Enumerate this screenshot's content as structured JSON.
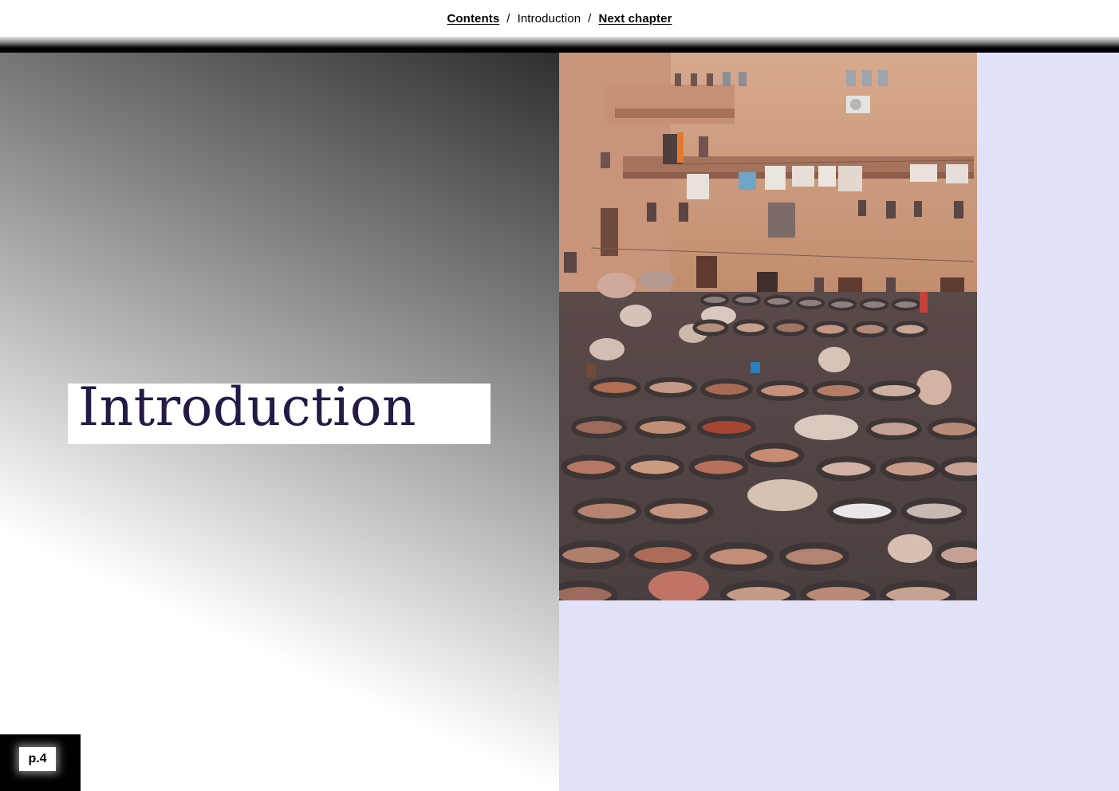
{
  "nav": {
    "contents_label": "Contents",
    "separator": "/",
    "current_label": "Introduction",
    "next_label": "Next chapter"
  },
  "chapter": {
    "title": "Introduction"
  },
  "page": {
    "label": "p.4"
  },
  "colors": {
    "title_text": "#241a45",
    "right_panel": "#e1e2f7",
    "badge_bg": "#000000"
  }
}
